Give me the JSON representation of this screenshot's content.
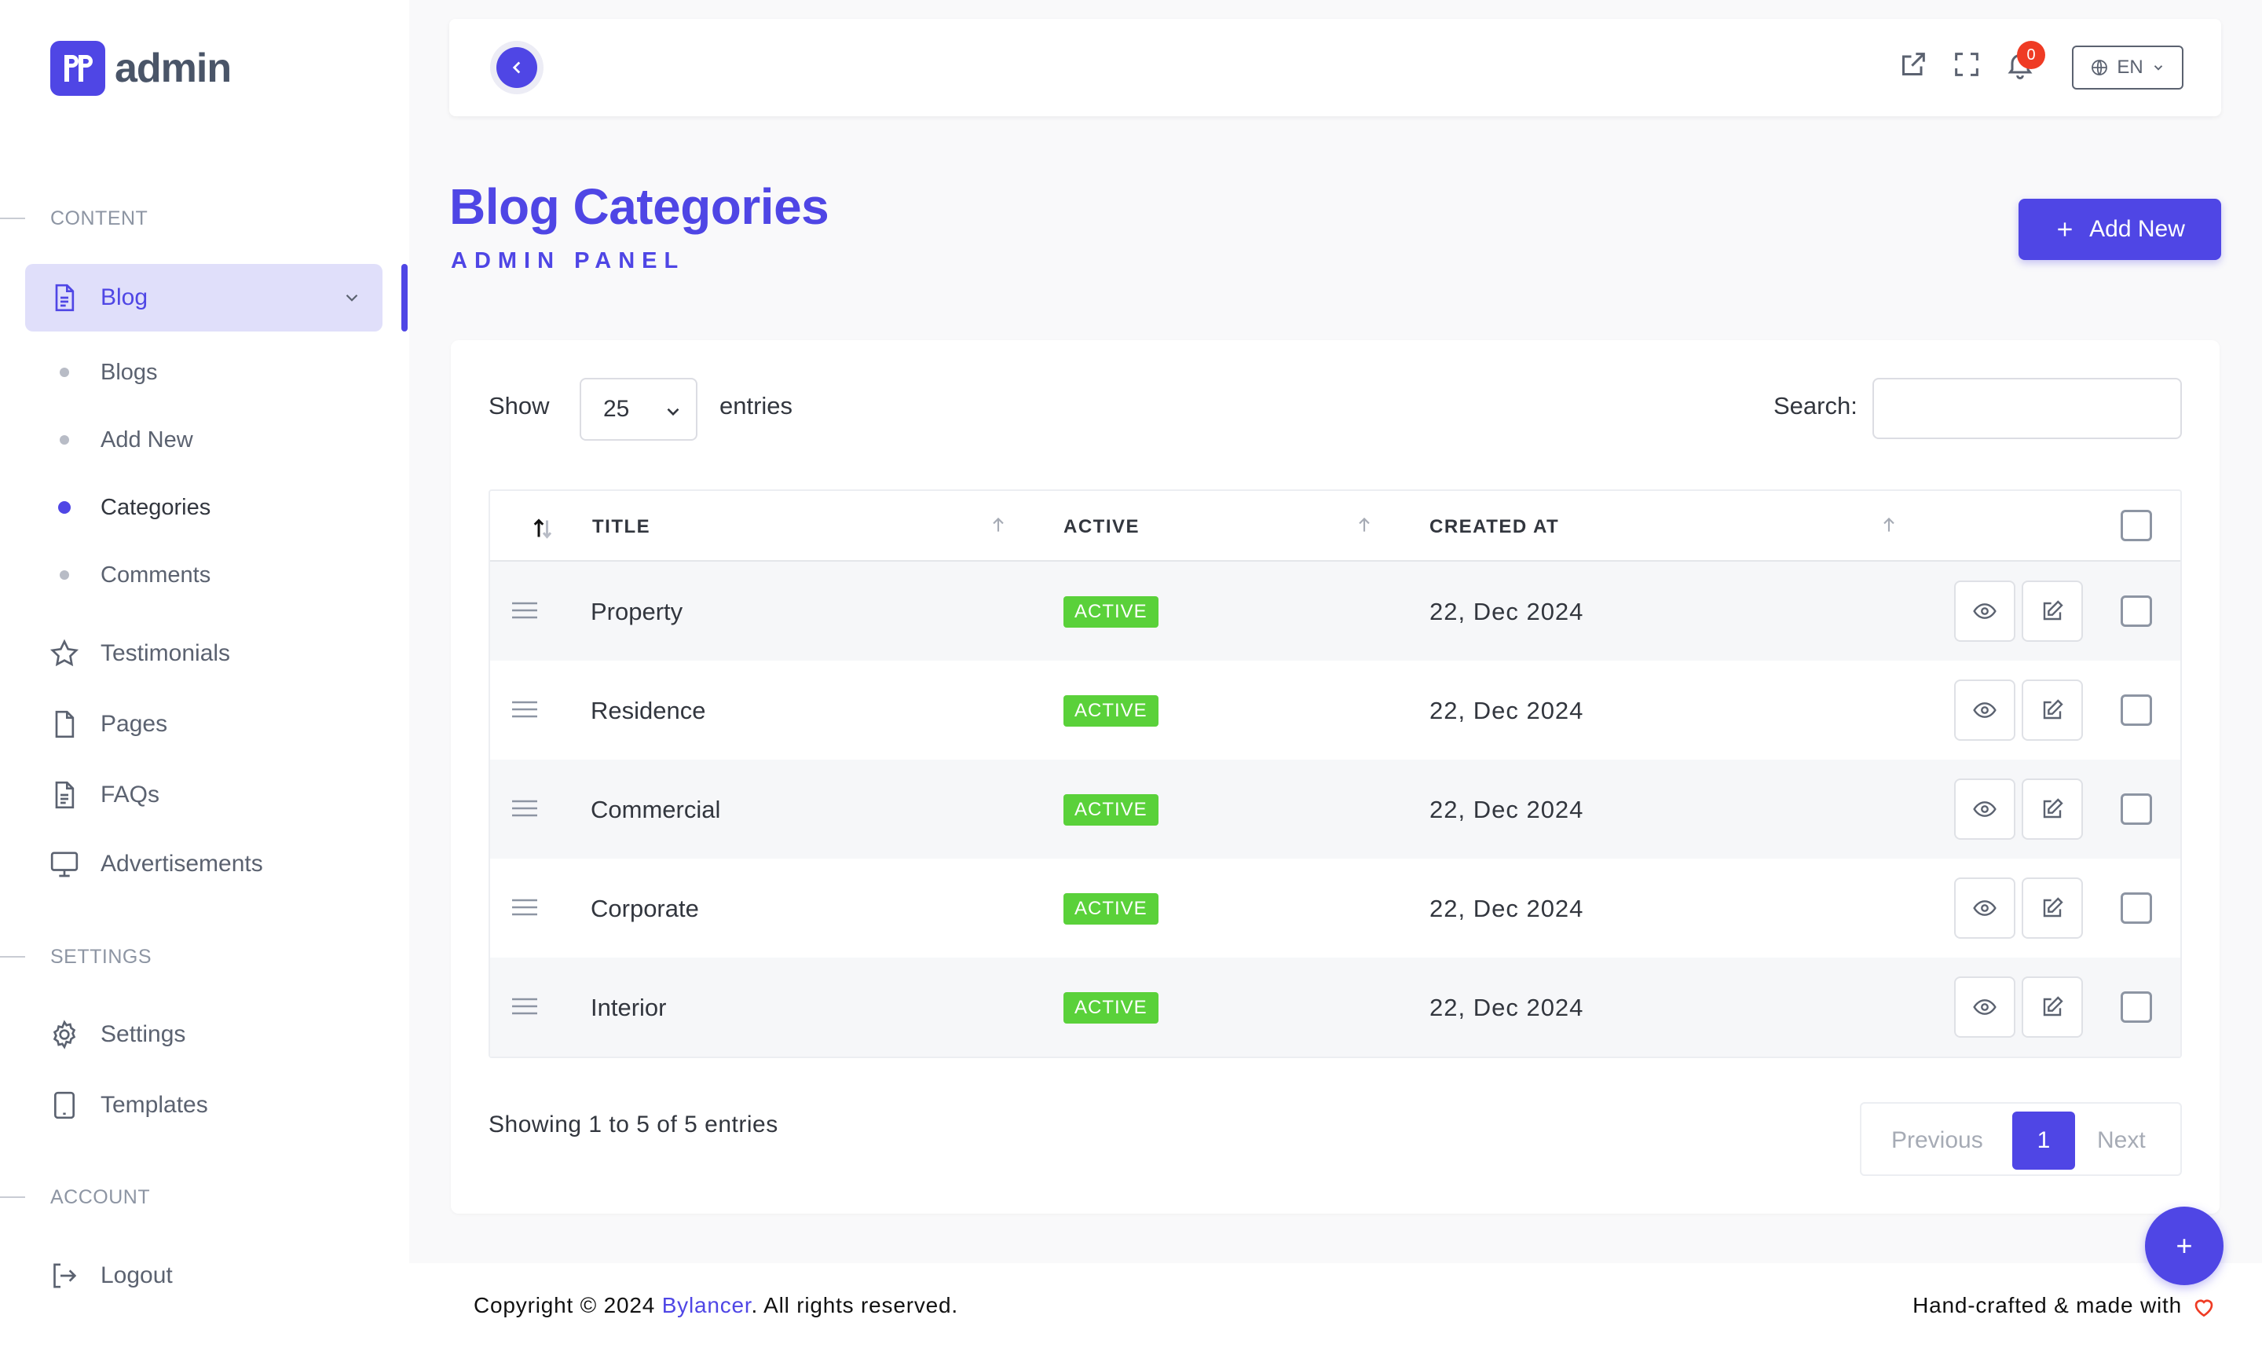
{
  "brand": {
    "name": "admin"
  },
  "sidebar": {
    "sections": [
      {
        "label": "CONTENT"
      },
      {
        "label": "SETTINGS"
      },
      {
        "label": "ACCOUNT"
      }
    ],
    "blog": {
      "label": "Blog"
    },
    "blog_sub": [
      "Blogs",
      "Add New",
      "Categories",
      "Comments"
    ],
    "items": [
      "Testimonials",
      "Pages",
      "FAQs",
      "Advertisements"
    ],
    "settings_items": [
      "Settings",
      "Templates"
    ],
    "account_items": [
      "Logout"
    ]
  },
  "topbar": {
    "notifications_count": "0",
    "language": "EN"
  },
  "page": {
    "title": "Blog Categories",
    "subtitle": "ADMIN PANEL",
    "add_label": "Add New"
  },
  "table_controls": {
    "show_label": "Show",
    "entries_value": "25",
    "entries_label": "entries",
    "search_label": "Search:"
  },
  "table": {
    "headers": [
      "TITLE",
      "ACTIVE",
      "CREATED AT"
    ],
    "rows": [
      {
        "title": "Property",
        "status": "ACTIVE",
        "created": "22, Dec 2024"
      },
      {
        "title": "Residence",
        "status": "ACTIVE",
        "created": "22, Dec 2024"
      },
      {
        "title": "Commercial",
        "status": "ACTIVE",
        "created": "22, Dec 2024"
      },
      {
        "title": "Corporate",
        "status": "ACTIVE",
        "created": "22, Dec 2024"
      },
      {
        "title": "Interior",
        "status": "ACTIVE",
        "created": "22, Dec 2024"
      }
    ]
  },
  "pagination": {
    "info": "Showing 1 to 5 of 5 entries",
    "previous": "Previous",
    "current": "1",
    "next": "Next"
  },
  "footer": {
    "copyright_prefix": "Copyright © 2024 ",
    "company": "Bylancer",
    "copyright_suffix": ". All rights reserved.",
    "made_with": "Hand-crafted & made with"
  },
  "fab": {
    "label": "+"
  },
  "colors": {
    "accent": "#4f46e5",
    "active_badge": "#5ad13a",
    "notification": "#ef3b24"
  }
}
